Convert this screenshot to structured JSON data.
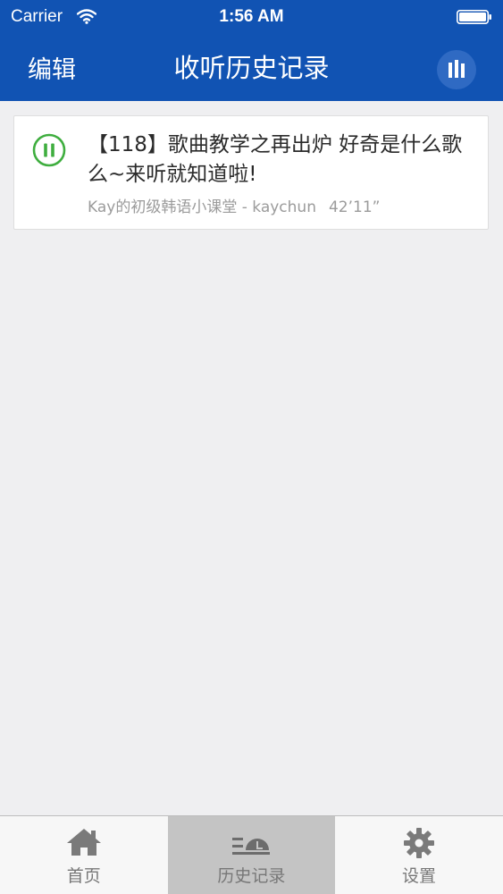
{
  "status_bar": {
    "carrier": "Carrier",
    "time": "1:56 AM"
  },
  "nav": {
    "edit_label": "编辑",
    "title": "收听历史记录"
  },
  "history": {
    "items": [
      {
        "title": "【118】歌曲教学之再出炉 好奇是什么歌么~来听就知道啦!",
        "channel": "Kay的初级韩语小课堂 - kaychun",
        "duration": "42’11”"
      }
    ]
  },
  "tabs": [
    {
      "label": "首页",
      "icon": "home-icon"
    },
    {
      "label": "历史记录",
      "icon": "history-icon"
    },
    {
      "label": "设置",
      "icon": "gear-icon"
    }
  ],
  "colors": {
    "nav_blue": "#1153b3",
    "play_green": "#3fae3f",
    "tab_active": "#c4c4c4"
  }
}
